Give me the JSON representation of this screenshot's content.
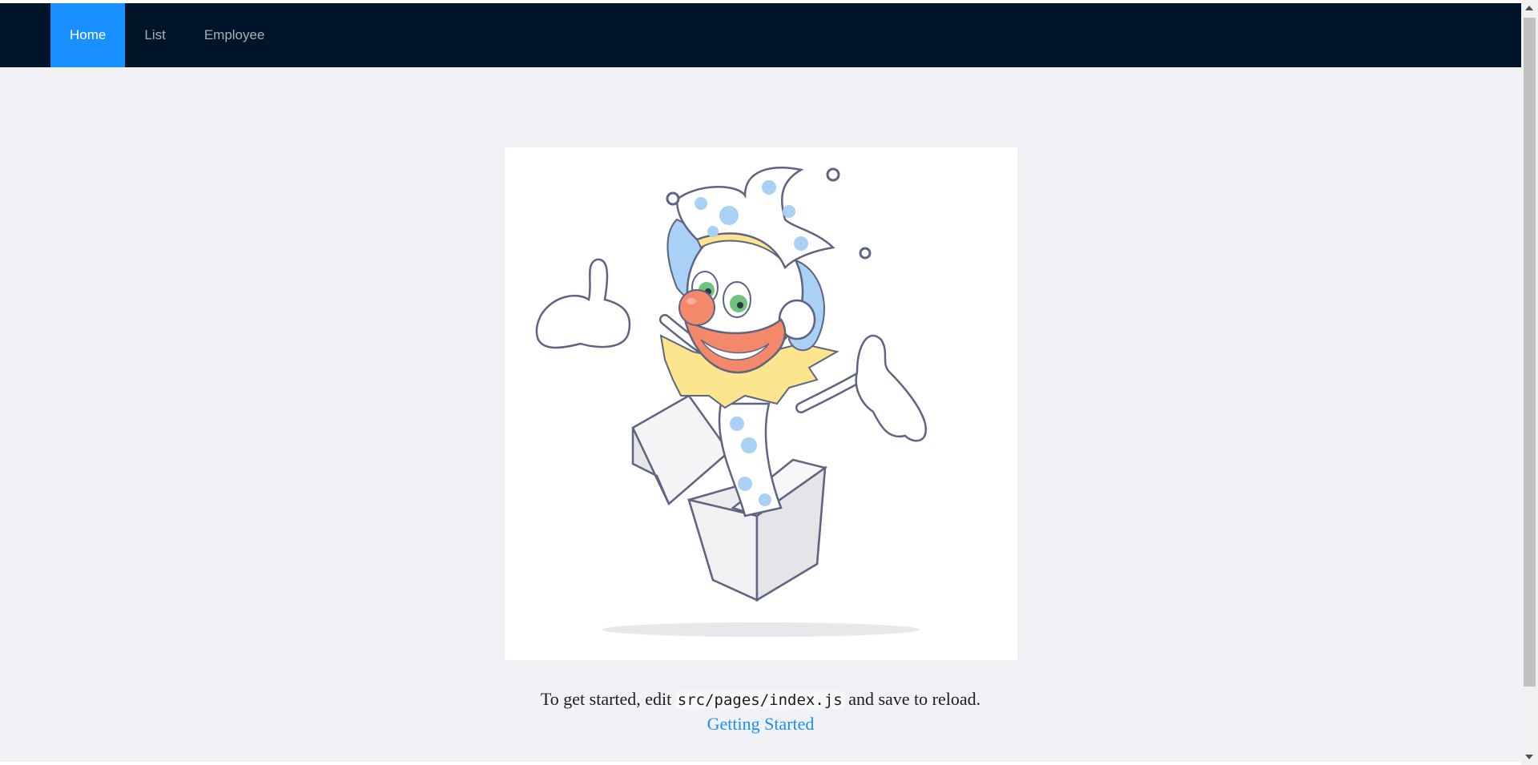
{
  "nav": {
    "items": [
      {
        "label": "Home",
        "active": true
      },
      {
        "label": "List",
        "active": false
      },
      {
        "label": "Employee",
        "active": false
      }
    ]
  },
  "main": {
    "illustration": "jack-in-the-box-clown-illustration",
    "intro_before": "To get started, edit ",
    "intro_code": "src/pages/index.js",
    "intro_after": " and save to reload.",
    "link_label": "Getting Started"
  },
  "colors": {
    "header_bg": "#001529",
    "active_tab": "#1890ff",
    "page_bg": "#f0f2f5",
    "link": "#1890ff"
  }
}
